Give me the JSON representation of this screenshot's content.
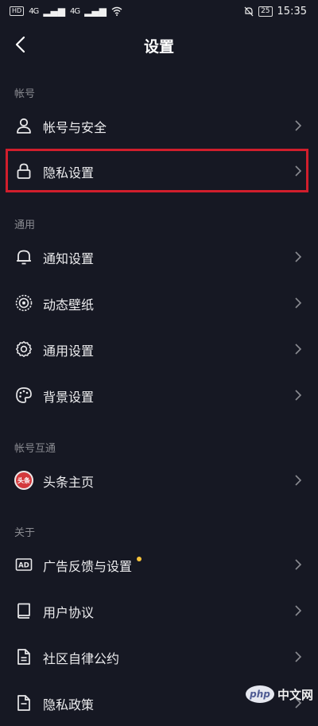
{
  "status_bar": {
    "left_badge": "HD",
    "signal_1": "4G",
    "signal_2": "4G",
    "battery": "25",
    "time": "15:35"
  },
  "navbar": {
    "title": "设置"
  },
  "sections": [
    {
      "header": "帐号",
      "items": [
        {
          "label": "帐号与安全",
          "icon": "person-icon"
        },
        {
          "label": "隐私设置",
          "icon": "lock-icon"
        }
      ]
    },
    {
      "header": "通用",
      "items": [
        {
          "label": "通知设置",
          "icon": "bell-icon"
        },
        {
          "label": "动态壁纸",
          "icon": "wallpaper-icon"
        },
        {
          "label": "通用设置",
          "icon": "gear-icon"
        },
        {
          "label": "背景设置",
          "icon": "palette-icon"
        }
      ]
    },
    {
      "header": "帐号互通",
      "items": [
        {
          "label": "头条主页",
          "icon": "toutiao-icon",
          "icon_text": "头条"
        }
      ]
    },
    {
      "header": "关于",
      "items": [
        {
          "label": "广告反馈与设置",
          "icon": "ad-icon",
          "icon_text": "AD",
          "badge_color": "#f5c23a"
        },
        {
          "label": "用户协议",
          "icon": "book-icon"
        },
        {
          "label": "社区自律公约",
          "icon": "document-icon"
        },
        {
          "label": "隐私政策",
          "icon": "document-icon"
        }
      ]
    }
  ],
  "highlight_color": "#d11e2c",
  "watermark": {
    "logo": "php",
    "text": "中文网"
  }
}
